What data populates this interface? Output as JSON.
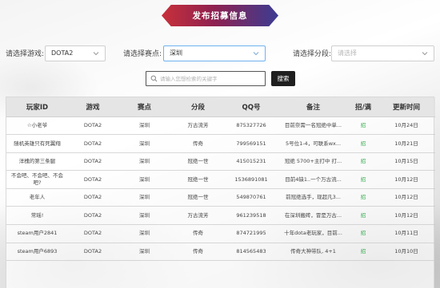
{
  "banner": {
    "title": "发布招募信息"
  },
  "filters": {
    "game": {
      "label": "请选择游戏:",
      "value": "DOTA2"
    },
    "venue": {
      "label": "请选择赛点:",
      "value": "深圳"
    },
    "tier": {
      "label": "请选择分段:",
      "placeholder": "请选择"
    }
  },
  "search": {
    "placeholder": "请输入您想检索的关键字",
    "button": "搜索"
  },
  "table": {
    "headers": [
      "玩家ID",
      "游戏",
      "赛点",
      "分段",
      "QQ号",
      "备注",
      "招/满",
      "更新时间"
    ],
    "rows": [
      {
        "id": "☆小老爷",
        "game": "DOTA2",
        "venue": "深圳",
        "tier": "万古流芳",
        "qq": "875327726",
        "note": "目前奈需一名冠绝中单...",
        "status": "招",
        "time": "10月24日"
      },
      {
        "id": "随机英雄只有死翼翔",
        "game": "DOTA2",
        "venue": "深圳",
        "tier": "传奇",
        "qq": "799569151",
        "note": "5号位1-4，可联系wx...",
        "status": "招",
        "time": "10月21日"
      },
      {
        "id": "洋槐的第三条腿",
        "game": "DOTA2",
        "venue": "深圳",
        "tier": "冠绝一世",
        "qq": "415015231",
        "note": "冠绝 5700+主打中 打...",
        "status": "招",
        "time": "10月15日"
      },
      {
        "id": "不会吧、不会吧、不会吧?",
        "game": "DOTA2",
        "venue": "深圳",
        "tier": "冠绝一世",
        "qq": "1536891081",
        "note": "目前4缺1..一个万古流...",
        "status": "招",
        "time": "10月12日"
      },
      {
        "id": "老年人",
        "game": "DOTA2",
        "venue": "深圳",
        "tier": "冠绝一世",
        "qq": "549870761",
        "note": "前冠绝选手，现超凡3...",
        "status": "招",
        "time": "10月12日"
      },
      {
        "id": "常瑶!",
        "game": "DOTA2",
        "venue": "深圳",
        "tier": "万古流芳",
        "qq": "961239518",
        "note": "在深圳搬砖，冒是万古...",
        "status": "招",
        "time": "10月12日"
      },
      {
        "id": "steam用户2841",
        "game": "DOTA2",
        "venue": "深圳",
        "tier": "传奇",
        "qq": "874721995",
        "note": "十年dota老玩家，目前...",
        "status": "招",
        "time": "10月11日"
      },
      {
        "id": "steam用户6893",
        "game": "DOTA2",
        "venue": "深圳",
        "tier": "传奇",
        "qq": "814565483",
        "note": "传奇大神带队, 4+1",
        "status": "招",
        "time": "10月10日"
      }
    ]
  },
  "colors": {
    "recruit": "#2faa4a",
    "banner_start": "#c8303a",
    "banner_end": "#3b3d93",
    "focus_border": "#6fb2ee"
  }
}
